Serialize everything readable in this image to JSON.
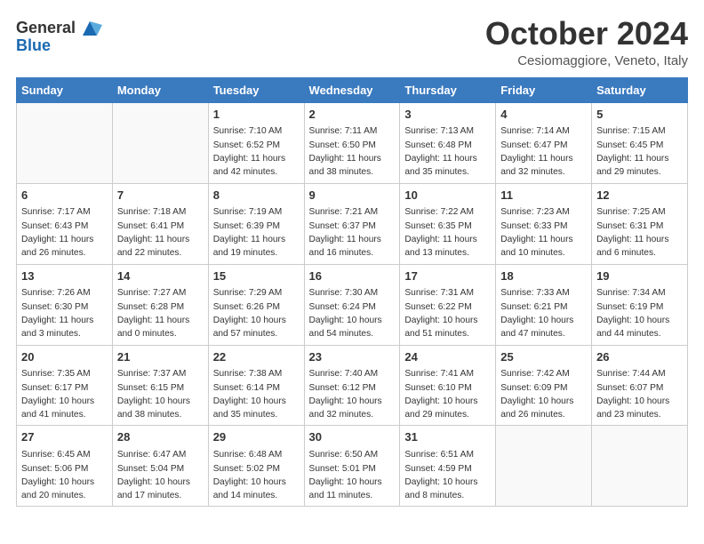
{
  "header": {
    "logo_general": "General",
    "logo_blue": "Blue",
    "month_title": "October 2024",
    "location": "Cesiomaggiore, Veneto, Italy"
  },
  "weekdays": [
    "Sunday",
    "Monday",
    "Tuesday",
    "Wednesday",
    "Thursday",
    "Friday",
    "Saturday"
  ],
  "weeks": [
    [
      {
        "day": "",
        "empty": true
      },
      {
        "day": "",
        "empty": true
      },
      {
        "day": "1",
        "sunrise": "Sunrise: 7:10 AM",
        "sunset": "Sunset: 6:52 PM",
        "daylight": "Daylight: 11 hours and 42 minutes."
      },
      {
        "day": "2",
        "sunrise": "Sunrise: 7:11 AM",
        "sunset": "Sunset: 6:50 PM",
        "daylight": "Daylight: 11 hours and 38 minutes."
      },
      {
        "day": "3",
        "sunrise": "Sunrise: 7:13 AM",
        "sunset": "Sunset: 6:48 PM",
        "daylight": "Daylight: 11 hours and 35 minutes."
      },
      {
        "day": "4",
        "sunrise": "Sunrise: 7:14 AM",
        "sunset": "Sunset: 6:47 PM",
        "daylight": "Daylight: 11 hours and 32 minutes."
      },
      {
        "day": "5",
        "sunrise": "Sunrise: 7:15 AM",
        "sunset": "Sunset: 6:45 PM",
        "daylight": "Daylight: 11 hours and 29 minutes."
      }
    ],
    [
      {
        "day": "6",
        "sunrise": "Sunrise: 7:17 AM",
        "sunset": "Sunset: 6:43 PM",
        "daylight": "Daylight: 11 hours and 26 minutes."
      },
      {
        "day": "7",
        "sunrise": "Sunrise: 7:18 AM",
        "sunset": "Sunset: 6:41 PM",
        "daylight": "Daylight: 11 hours and 22 minutes."
      },
      {
        "day": "8",
        "sunrise": "Sunrise: 7:19 AM",
        "sunset": "Sunset: 6:39 PM",
        "daylight": "Daylight: 11 hours and 19 minutes."
      },
      {
        "day": "9",
        "sunrise": "Sunrise: 7:21 AM",
        "sunset": "Sunset: 6:37 PM",
        "daylight": "Daylight: 11 hours and 16 minutes."
      },
      {
        "day": "10",
        "sunrise": "Sunrise: 7:22 AM",
        "sunset": "Sunset: 6:35 PM",
        "daylight": "Daylight: 11 hours and 13 minutes."
      },
      {
        "day": "11",
        "sunrise": "Sunrise: 7:23 AM",
        "sunset": "Sunset: 6:33 PM",
        "daylight": "Daylight: 11 hours and 10 minutes."
      },
      {
        "day": "12",
        "sunrise": "Sunrise: 7:25 AM",
        "sunset": "Sunset: 6:31 PM",
        "daylight": "Daylight: 11 hours and 6 minutes."
      }
    ],
    [
      {
        "day": "13",
        "sunrise": "Sunrise: 7:26 AM",
        "sunset": "Sunset: 6:30 PM",
        "daylight": "Daylight: 11 hours and 3 minutes."
      },
      {
        "day": "14",
        "sunrise": "Sunrise: 7:27 AM",
        "sunset": "Sunset: 6:28 PM",
        "daylight": "Daylight: 11 hours and 0 minutes."
      },
      {
        "day": "15",
        "sunrise": "Sunrise: 7:29 AM",
        "sunset": "Sunset: 6:26 PM",
        "daylight": "Daylight: 10 hours and 57 minutes."
      },
      {
        "day": "16",
        "sunrise": "Sunrise: 7:30 AM",
        "sunset": "Sunset: 6:24 PM",
        "daylight": "Daylight: 10 hours and 54 minutes."
      },
      {
        "day": "17",
        "sunrise": "Sunrise: 7:31 AM",
        "sunset": "Sunset: 6:22 PM",
        "daylight": "Daylight: 10 hours and 51 minutes."
      },
      {
        "day": "18",
        "sunrise": "Sunrise: 7:33 AM",
        "sunset": "Sunset: 6:21 PM",
        "daylight": "Daylight: 10 hours and 47 minutes."
      },
      {
        "day": "19",
        "sunrise": "Sunrise: 7:34 AM",
        "sunset": "Sunset: 6:19 PM",
        "daylight": "Daylight: 10 hours and 44 minutes."
      }
    ],
    [
      {
        "day": "20",
        "sunrise": "Sunrise: 7:35 AM",
        "sunset": "Sunset: 6:17 PM",
        "daylight": "Daylight: 10 hours and 41 minutes."
      },
      {
        "day": "21",
        "sunrise": "Sunrise: 7:37 AM",
        "sunset": "Sunset: 6:15 PM",
        "daylight": "Daylight: 10 hours and 38 minutes."
      },
      {
        "day": "22",
        "sunrise": "Sunrise: 7:38 AM",
        "sunset": "Sunset: 6:14 PM",
        "daylight": "Daylight: 10 hours and 35 minutes."
      },
      {
        "day": "23",
        "sunrise": "Sunrise: 7:40 AM",
        "sunset": "Sunset: 6:12 PM",
        "daylight": "Daylight: 10 hours and 32 minutes."
      },
      {
        "day": "24",
        "sunrise": "Sunrise: 7:41 AM",
        "sunset": "Sunset: 6:10 PM",
        "daylight": "Daylight: 10 hours and 29 minutes."
      },
      {
        "day": "25",
        "sunrise": "Sunrise: 7:42 AM",
        "sunset": "Sunset: 6:09 PM",
        "daylight": "Daylight: 10 hours and 26 minutes."
      },
      {
        "day": "26",
        "sunrise": "Sunrise: 7:44 AM",
        "sunset": "Sunset: 6:07 PM",
        "daylight": "Daylight: 10 hours and 23 minutes."
      }
    ],
    [
      {
        "day": "27",
        "sunrise": "Sunrise: 6:45 AM",
        "sunset": "Sunset: 5:06 PM",
        "daylight": "Daylight: 10 hours and 20 minutes."
      },
      {
        "day": "28",
        "sunrise": "Sunrise: 6:47 AM",
        "sunset": "Sunset: 5:04 PM",
        "daylight": "Daylight: 10 hours and 17 minutes."
      },
      {
        "day": "29",
        "sunrise": "Sunrise: 6:48 AM",
        "sunset": "Sunset: 5:02 PM",
        "daylight": "Daylight: 10 hours and 14 minutes."
      },
      {
        "day": "30",
        "sunrise": "Sunrise: 6:50 AM",
        "sunset": "Sunset: 5:01 PM",
        "daylight": "Daylight: 10 hours and 11 minutes."
      },
      {
        "day": "31",
        "sunrise": "Sunrise: 6:51 AM",
        "sunset": "Sunset: 4:59 PM",
        "daylight": "Daylight: 10 hours and 8 minutes."
      },
      {
        "day": "",
        "empty": true
      },
      {
        "day": "",
        "empty": true
      }
    ]
  ]
}
